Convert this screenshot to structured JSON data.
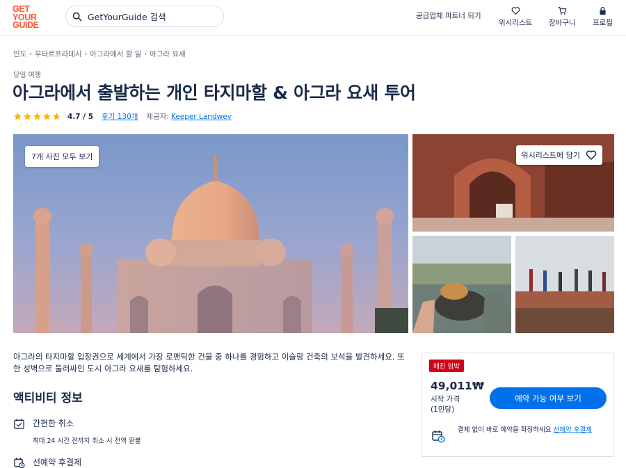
{
  "header": {
    "logo_line1": "GET",
    "logo_line2": "YOUR",
    "logo_line3": "GUIDE",
    "search_placeholder": "GetYourGuide 검색",
    "partner_label": "공급업체 파트너 되기",
    "wishlist_label": "위시리스트",
    "cart_label": "장바구니",
    "profile_label": "프로필"
  },
  "breadcrumb": [
    "인도",
    "우타르프라데시",
    "아그라에서 할 일",
    "아그라 요새"
  ],
  "activity": {
    "category": "당일 여행",
    "title": "아그라에서 출발하는 개인 타지마할 & 아그라 요새 투어",
    "rating": 4.7,
    "rating_text": "4.7 / 5",
    "reviews_text": "후기 130개",
    "provider_label": "제공자:",
    "provider_name": "Keeper Landwey"
  },
  "gallery": {
    "all_photos_label": "7개 사진 모두 보기",
    "wishlist_add_label": "위시리스트에 담기"
  },
  "description": "아그라의 타지마할 입장권으로 세계에서 가장 로맨틱한 건물 중 하나를 경험하고 이슬람 건축의 보석을 발견하세요. 또한 성벽으로 둘러싸인 도시 아그라 요새를 탐험하세요.",
  "info_section": {
    "title": "액티비티 정보",
    "items": [
      {
        "title": "간편한 취소",
        "sub": "최대 24 시간 전까지 취소 시 전액 환불"
      },
      {
        "title": "선예약 후결제",
        "sub": ""
      }
    ]
  },
  "booking": {
    "badge": "매진 임박",
    "price": "49,011₩",
    "price_label_line1": "시작 가격",
    "price_label_line2": "(1인당)",
    "check_button": "예약 가능 여부 보기",
    "reserve_text": "결제 없이 바로 예약을 확정하세요 ",
    "reserve_link": "선예약 후결제"
  },
  "colors": {
    "brand": "#ff5533",
    "primary": "#0071eb",
    "badge": "#d1001b",
    "star": "#ffb700",
    "text": "#1a2b49"
  }
}
